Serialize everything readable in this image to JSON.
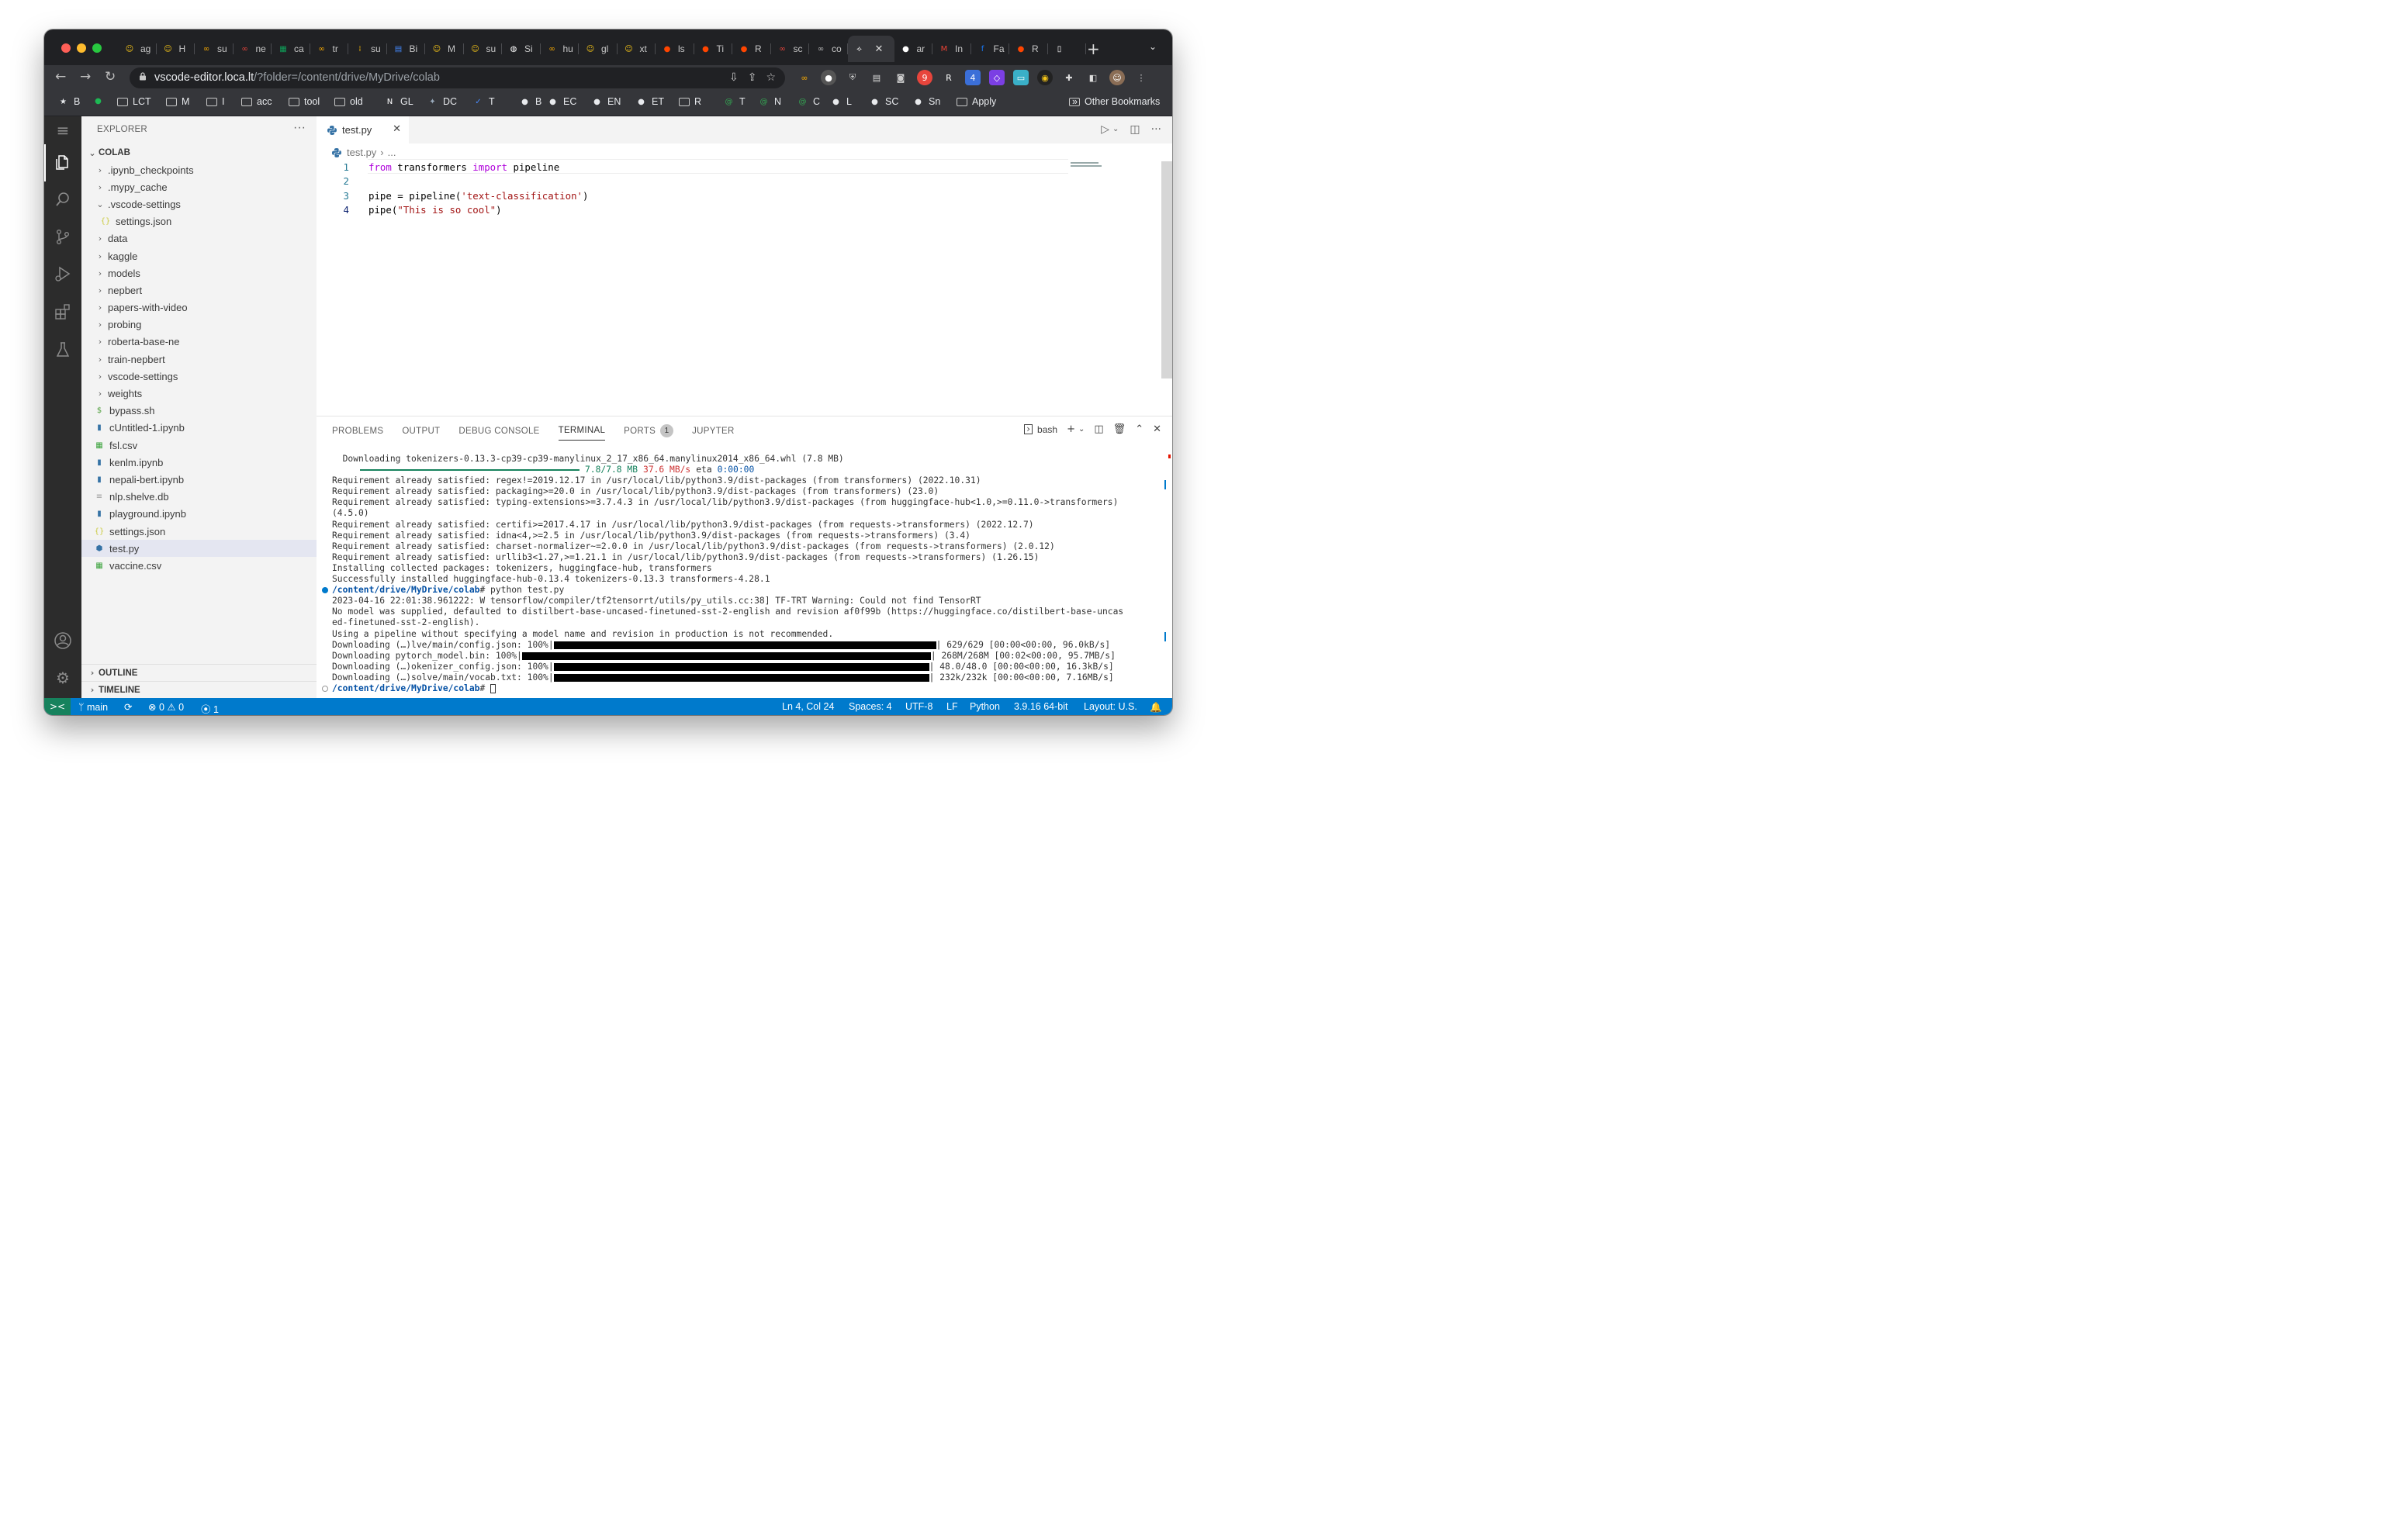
{
  "browser": {
    "tabs": [
      {
        "label": "ag",
        "icon": "hugging-face-icon",
        "color": "#f5c518"
      },
      {
        "label": "H",
        "icon": "hugging-face-icon",
        "color": "#f5c518"
      },
      {
        "label": "su",
        "icon": "colab-icon",
        "color": "#f9ab00"
      },
      {
        "label": "ne",
        "icon": "colab-icon",
        "color": "#e8453c"
      },
      {
        "label": "ca",
        "icon": "sheets-icon",
        "color": "#0f9d58"
      },
      {
        "label": "tr",
        "icon": "colab-icon",
        "color": "#f9ab00"
      },
      {
        "label": "su",
        "icon": "grid-icon",
        "color": "#fbbc04"
      },
      {
        "label": "Bi",
        "icon": "doc-icon",
        "color": "#4285f4"
      },
      {
        "label": "M",
        "icon": "hugging-face-icon",
        "color": "#f5c518"
      },
      {
        "label": "su",
        "icon": "hugging-face-icon",
        "color": "#f5c518"
      },
      {
        "label": "Si",
        "icon": "globe-icon",
        "color": "#ffffff"
      },
      {
        "label": "hu",
        "icon": "colab-icon",
        "color": "#f9ab00"
      },
      {
        "label": "gl",
        "icon": "hugging-face-icon",
        "color": "#f5c518"
      },
      {
        "label": "xt",
        "icon": "hugging-face-icon",
        "color": "#f5c518"
      },
      {
        "label": "ls",
        "icon": "reddit-icon",
        "color": "#ff4500"
      },
      {
        "label": "Ti",
        "icon": "reddit-icon",
        "color": "#ff4500"
      },
      {
        "label": "R",
        "icon": "reddit-icon",
        "color": "#ff4500"
      },
      {
        "label": "sc",
        "icon": "colab-icon",
        "color": "#e8453c"
      },
      {
        "label": "co",
        "icon": "colab-icon",
        "color": "#bdbdbd"
      },
      {
        "label": "",
        "icon": "vscode-tab-icon",
        "color": "#ffffff",
        "active": true
      },
      {
        "label": "ar",
        "icon": "github-icon",
        "color": "#ffffff"
      },
      {
        "label": "In",
        "icon": "gmail-icon",
        "color": "#ea4335"
      },
      {
        "label": "Fa",
        "icon": "facebook-icon",
        "color": "#1877f2"
      },
      {
        "label": "R",
        "icon": "reddit-icon",
        "color": "#ff4500"
      },
      {
        "label": "",
        "icon": "blank-page-icon",
        "color": "#ffffff"
      }
    ],
    "url_host": "vscode-editor.loca.lt",
    "url_path": "/?folder=/content/drive/MyDrive/colab",
    "bookmarks": [
      {
        "label": "B",
        "icon": "star-icon"
      },
      {
        "label": "",
        "icon": "spotify-icon"
      },
      {
        "label": "LCT",
        "icon": "folder-icon"
      },
      {
        "label": "M",
        "icon": "folder-icon"
      },
      {
        "label": "I",
        "icon": "folder-icon"
      },
      {
        "label": "acc",
        "icon": "folder-icon"
      },
      {
        "label": "tool",
        "icon": "folder-icon"
      },
      {
        "label": "old",
        "icon": "folder-icon"
      },
      {
        "label": "GL",
        "icon": "notion-icon"
      },
      {
        "label": "DC",
        "icon": "medal-icon"
      },
      {
        "label": "T",
        "icon": "check-icon"
      },
      {
        "label": "B",
        "icon": "github-icon"
      },
      {
        "label": "EC",
        "icon": "github-icon"
      },
      {
        "label": "EN",
        "icon": "github-icon"
      },
      {
        "label": "ET",
        "icon": "github-icon"
      },
      {
        "label": "R",
        "icon": "folder-icon"
      },
      {
        "label": "T",
        "icon": "at-icon"
      },
      {
        "label": "N",
        "icon": "at-icon"
      },
      {
        "label": "C",
        "icon": "at-icon"
      },
      {
        "label": "L",
        "icon": "github-icon"
      },
      {
        "label": "SC",
        "icon": "github-icon"
      },
      {
        "label": "Sn",
        "icon": "github-icon"
      },
      {
        "label": "Apply",
        "icon": "folder-icon"
      }
    ],
    "more_bookmarks": "»",
    "other_bookmarks": "Other Bookmarks"
  },
  "explorer": {
    "title": "EXPLORER",
    "more": "···",
    "root": "COLAB",
    "items": [
      {
        "label": ".ipynb_checkpoints",
        "type": "folder",
        "depth": 1,
        "open": false
      },
      {
        "label": ".mypy_cache",
        "type": "folder",
        "depth": 1,
        "open": false
      },
      {
        "label": ".vscode-settings",
        "type": "folder",
        "depth": 1,
        "open": true
      },
      {
        "label": "settings.json",
        "type": "json",
        "depth": 2
      },
      {
        "label": "data",
        "type": "folder",
        "depth": 1,
        "open": false
      },
      {
        "label": "kaggle",
        "type": "folder",
        "depth": 1,
        "open": false
      },
      {
        "label": "models",
        "type": "folder",
        "depth": 1,
        "open": false
      },
      {
        "label": "nepbert",
        "type": "folder",
        "depth": 1,
        "open": false
      },
      {
        "label": "papers-with-video",
        "type": "folder",
        "depth": 1,
        "open": false
      },
      {
        "label": "probing",
        "type": "folder",
        "depth": 1,
        "open": false
      },
      {
        "label": "roberta-base-ne",
        "type": "folder",
        "depth": 1,
        "open": false
      },
      {
        "label": "train-nepbert",
        "type": "folder",
        "depth": 1,
        "open": false
      },
      {
        "label": "vscode-settings",
        "type": "folder",
        "depth": 1,
        "open": false
      },
      {
        "label": "weights",
        "type": "folder",
        "depth": 1,
        "open": false
      },
      {
        "label": "bypass.sh",
        "type": "shell",
        "depth": 1
      },
      {
        "label": "cUntitled-1.ipynb",
        "type": "notebook",
        "depth": 1
      },
      {
        "label": "fsl.csv",
        "type": "csv",
        "depth": 1
      },
      {
        "label": "kenlm.ipynb",
        "type": "notebook",
        "depth": 1
      },
      {
        "label": "nepali-bert.ipynb",
        "type": "notebook",
        "depth": 1
      },
      {
        "label": "nlp.shelve.db",
        "type": "db",
        "depth": 1
      },
      {
        "label": "playground.ipynb",
        "type": "notebook",
        "depth": 1
      },
      {
        "label": "settings.json",
        "type": "json",
        "depth": 1
      },
      {
        "label": "test.py",
        "type": "python",
        "depth": 1,
        "selected": true
      },
      {
        "label": "vaccine.csv",
        "type": "csv",
        "depth": 1
      }
    ],
    "outline": "OUTLINE",
    "timeline": "TIMELINE"
  },
  "editor": {
    "tab_label": "test.py",
    "close": "✕",
    "breadcrumb_file": "test.py",
    "breadcrumb_more": "...",
    "breadcrumb_sep": "›",
    "lines": [
      {
        "n": "1",
        "tokens": [
          {
            "t": "from",
            "c": "kw"
          },
          {
            "t": " transformers ",
            "c": ""
          },
          {
            "t": "import",
            "c": "kw"
          },
          {
            "t": " pipeline",
            "c": ""
          }
        ]
      },
      {
        "n": "2",
        "tokens": []
      },
      {
        "n": "3",
        "tokens": [
          {
            "t": "pipe = pipeline(",
            "c": ""
          },
          {
            "t": "'text-classification'",
            "c": "str"
          },
          {
            "t": ")",
            "c": ""
          }
        ]
      },
      {
        "n": "4",
        "tokens": [
          {
            "t": "pipe(",
            "c": ""
          },
          {
            "t": "\"This is so cool\"",
            "c": "str"
          },
          {
            "t": ")",
            "c": ""
          }
        ],
        "current": true
      }
    ]
  },
  "panel": {
    "tabs": [
      "PROBLEMS",
      "OUTPUT",
      "DEBUG CONSOLE",
      "TERMINAL",
      "PORTS",
      "JUPYTER"
    ],
    "active_tab": "TERMINAL",
    "ports_badge": "1",
    "shell": "bash",
    "terminal": {
      "download_line": "  Downloading tokenizers-0.13.3-cp39-cp39-manylinux_2_17_x86_64.manylinux2014_x86_64.whl (7.8 MB)",
      "download_size": "7.8/7.8 MB",
      "download_speed": "37.6 MB/s",
      "download_eta_label": "eta",
      "download_eta": "0:00:00",
      "lines_a": [
        "Requirement already satisfied: regex!=2019.12.17 in /usr/local/lib/python3.9/dist-packages (from transformers) (2022.10.31)",
        "Requirement already satisfied: packaging>=20.0 in /usr/local/lib/python3.9/dist-packages (from transformers) (23.0)",
        "Requirement already satisfied: typing-extensions>=3.7.4.3 in /usr/local/lib/python3.9/dist-packages (from huggingface-hub<1.0,>=0.11.0->transformers)",
        "(4.5.0)",
        "Requirement already satisfied: certifi>=2017.4.17 in /usr/local/lib/python3.9/dist-packages (from requests->transformers) (2022.12.7)",
        "Requirement already satisfied: idna<4,>=2.5 in /usr/local/lib/python3.9/dist-packages (from requests->transformers) (3.4)",
        "Requirement already satisfied: charset-normalizer~=2.0.0 in /usr/local/lib/python3.9/dist-packages (from requests->transformers) (2.0.12)",
        "Requirement already satisfied: urllib3<1.27,>=1.21.1 in /usr/local/lib/python3.9/dist-packages (from requests->transformers) (1.26.15)",
        "Installing collected packages: tokenizers, huggingface-hub, transformers",
        "Successfully installed huggingface-hub-0.13.4 tokenizers-0.13.3 transformers-4.28.1"
      ],
      "prompt_path": "/content/drive/MyDrive/colab",
      "prompt_suffix": "#",
      "command": " python test.py",
      "lines_b": [
        "2023-04-16 22:01:38.961222: W tensorflow/compiler/tf2tensorrt/utils/py_utils.cc:38] TF-TRT Warning: Could not find TensorRT",
        "No model was supplied, defaulted to distilbert-base-uncased-finetuned-sst-2-english and revision af0f99b (https://huggingface.co/distilbert-base-uncas",
        "ed-finetuned-sst-2-english).",
        "Using a pipeline without specifying a model name and revision in production is not recommended."
      ],
      "progress": [
        {
          "label": "Downloading (…)lve/main/config.json: 100%|",
          "stats": "| 629/629 [00:00<00:00, 96.0kB/s]"
        },
        {
          "label": "Downloading pytorch_model.bin: 100%|",
          "stats": "| 268M/268M [00:02<00:00, 95.7MB/s]"
        },
        {
          "label": "Downloading (…)okenizer_config.json: 100%|",
          "stats": "| 48.0/48.0 [00:00<00:00, 16.3kB/s]"
        },
        {
          "label": "Downloading (…)solve/main/vocab.txt: 100%|",
          "stats": "| 232k/232k [00:00<00:00, 7.16MB/s]"
        }
      ]
    }
  },
  "statusbar": {
    "remote": "><",
    "branch": "main",
    "sync": "⟳",
    "errors": "0",
    "warnings": "0",
    "ports": "1",
    "position": "Ln 4, Col 24",
    "spaces": "Spaces: 4",
    "encoding": "UTF-8",
    "eol": "LF",
    "language": "Python",
    "interpreter": "3.9.16 64-bit",
    "layout": "Layout: U.S."
  },
  "colors": {
    "status_blue": "#007acc",
    "remote_green": "#16825d",
    "keyword": "#af00db",
    "string": "#a31515",
    "path": "#0451a5"
  }
}
